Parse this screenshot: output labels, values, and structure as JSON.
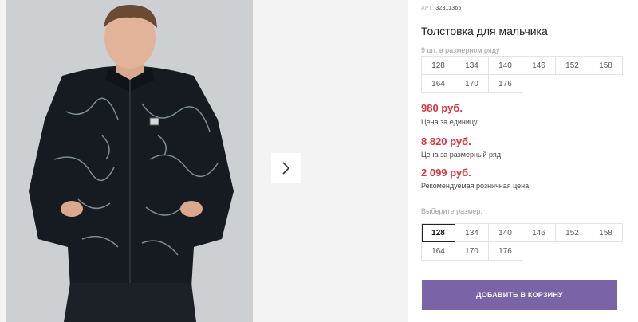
{
  "product": {
    "art_label": "АРТ.",
    "art_number": "32311365",
    "title": "Толстовка для мальчика"
  },
  "pack": {
    "note": "9 шт. в размерном ряду",
    "sizes": [
      "128",
      "134",
      "140",
      "146",
      "152",
      "158",
      "164",
      "170",
      "176"
    ]
  },
  "prices": {
    "unit_price": "980 руб.",
    "unit_label": "Цена за единицу",
    "pack_price": "8 820 руб.",
    "pack_label": "Цена за размерный ряд",
    "retail_price": "2 099 руб.",
    "retail_label": "Рекомендуемая розничная цена",
    "accent_color": "#d8343f"
  },
  "size_select": {
    "label": "Выберите размер:",
    "selected": "128",
    "sizes": [
      "128",
      "134",
      "140",
      "146",
      "152",
      "158",
      "164",
      "170",
      "176"
    ]
  },
  "cart": {
    "button_label": "ДОБАВИТЬ В КОРЗИНУ",
    "button_color": "#7a64a8"
  },
  "gallery": {
    "next_icon": "chevron-right-icon"
  }
}
